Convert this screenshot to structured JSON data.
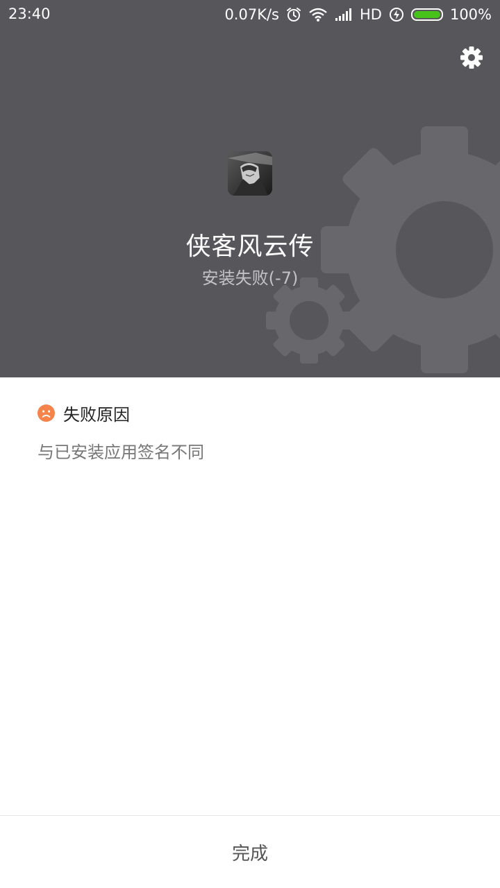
{
  "status_bar": {
    "time": "23:40",
    "net_speed": "0.07K/s",
    "network_type": "HD",
    "battery_percent": "100%",
    "battery_level": 1.0,
    "icons": [
      "alarm-icon",
      "wifi-icon",
      "signal-icon",
      "charging-icon",
      "battery-icon"
    ]
  },
  "header": {
    "background_color": "#57565b",
    "settings_icon": "gear-icon",
    "app_name": "侠客风云传",
    "install_status": "安装失败(-7)"
  },
  "failure": {
    "icon": "sad-face-icon",
    "icon_color": "#f5834a",
    "title": "失败原因",
    "detail": "与已安装应用签名不同"
  },
  "footer": {
    "done_label": "完成"
  }
}
